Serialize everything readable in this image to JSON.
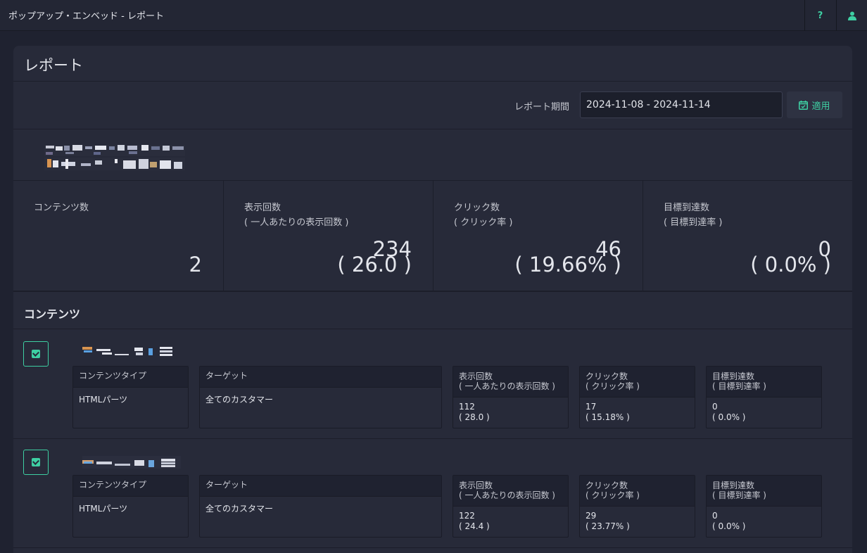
{
  "topbar": {
    "title": "ポップアップ・エンベッド - レポート",
    "help_label": "?",
    "help_icon": "help-icon",
    "user_icon": "user-icon"
  },
  "report": {
    "title": "レポート",
    "period_label": "レポート期間",
    "period_value": "2024-11-08 - 2024-11-14",
    "apply_label": "適用",
    "apply_icon": "calendar-check-icon"
  },
  "stats": [
    {
      "label_1": "コンテンツ数",
      "label_2": "",
      "value": "2",
      "sub": ""
    },
    {
      "label_1": "表示回数",
      "label_2": "( 一人あたりの表示回数 )",
      "value": "234",
      "sub": "( 26.0 )"
    },
    {
      "label_1": "クリック数",
      "label_2": "( クリック率 )",
      "value": "46",
      "sub": "( 19.66% )"
    },
    {
      "label_1": "目標到達数",
      "label_2": "( 目標到達率 )",
      "value": "0",
      "sub": "( 0.0% )"
    }
  ],
  "contents_section": {
    "title": "コンテンツ",
    "col_type": "コンテンツタイプ",
    "col_target": "ターゲット",
    "col_views": "表示回数",
    "col_views_sub": "( 一人あたりの表示回数 )",
    "col_clicks": "クリック数",
    "col_clicks_sub": "( クリック率 )",
    "col_goals": "目標到達数",
    "col_goals_sub": "( 目標到達率 )"
  },
  "contents": [
    {
      "type": "HTMLパーツ",
      "target": "全てのカスタマー",
      "views": "112",
      "views_sub": "( 28.0 )",
      "clicks": "17",
      "clicks_sub": "( 15.18% )",
      "goals": "0",
      "goals_sub": "( 0.0% )"
    },
    {
      "type": "HTMLパーツ",
      "target": "全てのカスタマー",
      "views": "122",
      "views_sub": "( 24.4 )",
      "clicks": "29",
      "clicks_sub": "( 23.77% )",
      "goals": "0",
      "goals_sub": "( 0.0% )"
    }
  ],
  "colors": {
    "accent": "#3ecfa3",
    "background": "#1f2230",
    "card": "#272a39"
  }
}
